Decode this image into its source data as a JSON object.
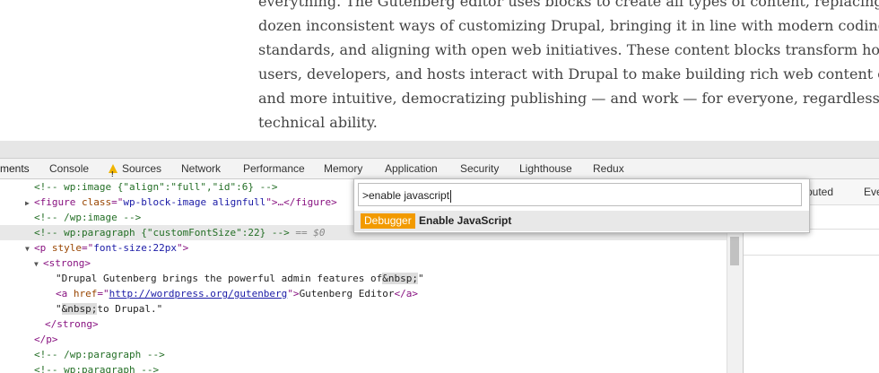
{
  "article": {
    "lines": [
      "everything. The Gutenberg editor uses blocks to create all types of content, replacing a half",
      "dozen inconsistent ways of customizing Drupal, bringing it in line with modern coding",
      "standards, and aligning with open web initiatives. These content blocks transform how",
      "users, developers, and hosts interact with Drupal to make building rich web content easier",
      "and more intuitive, democratizing publishing — and work — for everyone, regardless of",
      "technical ability."
    ]
  },
  "devtools": {
    "tabs": [
      "ments",
      "Console",
      "Sources",
      "Network",
      "Performance",
      "Memory",
      "Application",
      "Security",
      "Lighthouse",
      "Redux"
    ],
    "active_tab": "ments",
    "sources_warning_icon": "warning-icon"
  },
  "elements": {
    "l1": {
      "comment": "<!-- wp:image {\"align\":\"full\",\"id\":6} -->"
    },
    "l2": {
      "open": "<figure ",
      "attr": "class",
      "eq": "=\"",
      "val": "wp-block-image alignfull",
      "close": "\">…</figure>"
    },
    "l3": {
      "comment": "<!-- /wp:image -->"
    },
    "l4": {
      "comment": "<!-- wp:paragraph {\"customFontSize\":22} -->",
      "suffix": " == $0"
    },
    "l5": {
      "open": "<p ",
      "attr": "style",
      "eq": "=\"",
      "val": "font-size:22px",
      "close": "\">"
    },
    "l6": {
      "tag": "<strong>"
    },
    "l7": {
      "text": "\"Drupal Gutenberg brings the powerful admin features of",
      "entity": "&nbsp;",
      "end": "\""
    },
    "l8": {
      "open": "<a ",
      "attr": "href",
      "eq": "=\"",
      "link": "http://wordpress.org/gutenberg",
      "close": "\">",
      "text": "Gutenberg Editor",
      "endtag": "</a>"
    },
    "l9": {
      "q": "\"",
      "entity": "&nbsp;",
      "text": "to Drupal.\""
    },
    "l10": {
      "tag": "</strong>"
    },
    "l11": {
      "tag": "</p>"
    },
    "l12": {
      "comment": "<!-- /wp:paragraph -->"
    },
    "l13": {
      "comment": "<!-- wp:paragraph -->"
    }
  },
  "styles_panel": {
    "tab_computed": "mputed",
    "tab_event": "Eve"
  },
  "command_menu": {
    "input_value": ">enable javascript",
    "item_badge": "Debugger",
    "item_title": "Enable JavaScript"
  }
}
